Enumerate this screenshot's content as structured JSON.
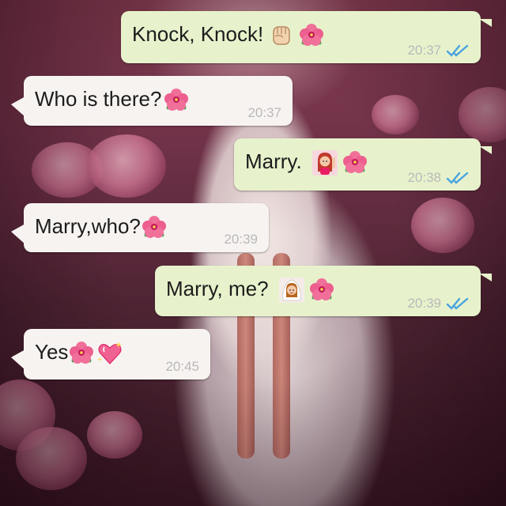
{
  "conversation": {
    "messages": [
      {
        "direction": "outgoing",
        "text": "Knock, Knock!",
        "emojis": [
          "raised-fist-icon",
          "hibiscus-icon"
        ],
        "time": "20:37",
        "status": "read"
      },
      {
        "direction": "incoming",
        "text": "Who is there?",
        "emojis": [
          "hibiscus-icon"
        ],
        "time": "20:37"
      },
      {
        "direction": "outgoing",
        "text": "Marry.",
        "emojis": [
          "woman-raising-hand-icon",
          "hibiscus-icon"
        ],
        "time": "20:38",
        "status": "read"
      },
      {
        "direction": "incoming",
        "text": "Marry,who?",
        "emojis": [
          "hibiscus-icon"
        ],
        "time": "20:39"
      },
      {
        "direction": "outgoing",
        "text": "Marry, me?",
        "emojis": [
          "bride-with-veil-icon",
          "hibiscus-icon"
        ],
        "time": "20:39",
        "status": "read"
      },
      {
        "direction": "incoming",
        "text": "Yes",
        "emojis": [
          "hibiscus-icon",
          "sparkling-heart-icon"
        ],
        "time": "20:45"
      }
    ]
  },
  "colors": {
    "incoming_bubble": "#f7f3f1",
    "outgoing_bubble": "#e7f2cc",
    "timestamp": "#b9b9b9",
    "read_ticks": "#4aa3df"
  }
}
